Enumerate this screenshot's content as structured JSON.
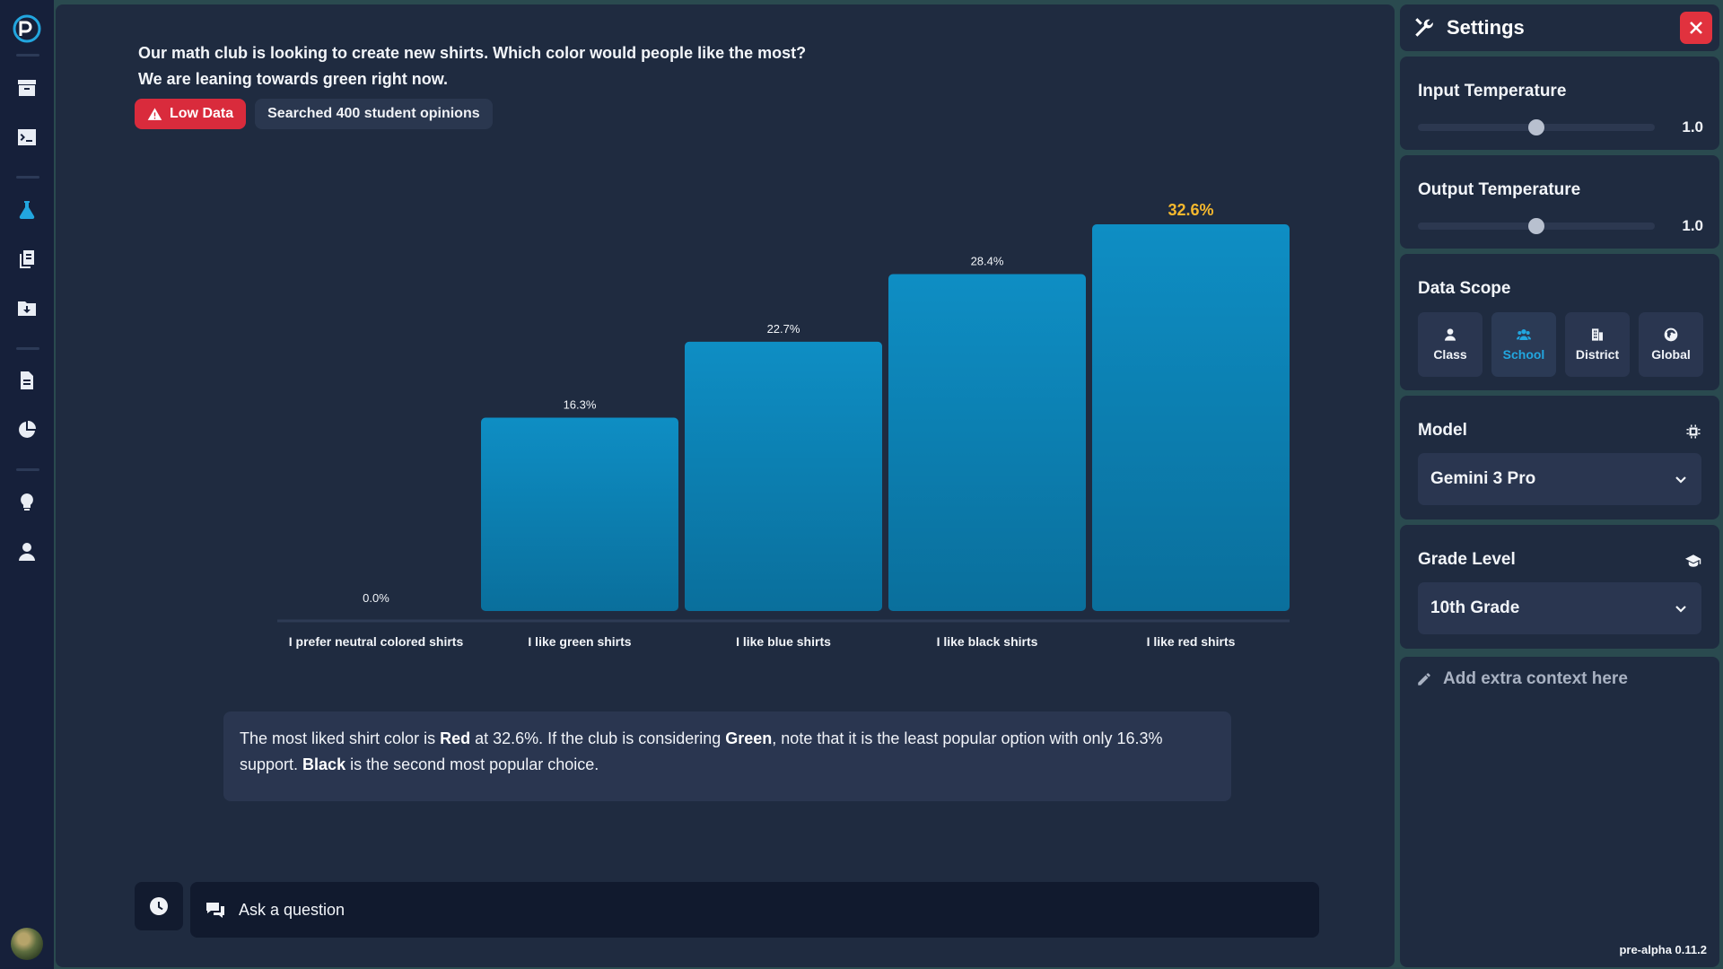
{
  "rail": {
    "icons": [
      "logo-icon",
      "archive-icon",
      "terminal-icon",
      "flask-icon",
      "copy-icon",
      "folder-download-icon",
      "document-icon",
      "pie-chart-icon",
      "lightbulb-icon",
      "user-icon"
    ],
    "active": "flask-icon"
  },
  "question": {
    "line1": "Our math club is looking to create new shirts. Which color would people like the most?",
    "line2": "We are leaning towards green right now."
  },
  "badges": {
    "warning": "Low Data",
    "searched": "Searched 400 student opinions"
  },
  "chart_data": {
    "type": "bar",
    "categories": [
      "I prefer neutral colored shirts",
      "I like green shirts",
      "I like blue shirts",
      "I like black shirts",
      "I like red shirts"
    ],
    "values": [
      0.0,
      16.3,
      22.7,
      28.4,
      32.6
    ],
    "data_labels": [
      "0.0%",
      "16.3%",
      "22.7%",
      "28.4%",
      "32.6%"
    ],
    "highlighted": "I like red shirts",
    "ylim": [
      0,
      32.6
    ],
    "colors": {
      "bar": "#0c8bbf",
      "highlight_label": "#f5b82e",
      "label": "#f2f5f9"
    }
  },
  "summary": {
    "p1": "The most liked shirt color is ",
    "b1": "Red",
    "p2": " at 32.6%. If the club is considering ",
    "b2": "Green",
    "p3": ", note that it is the least popular option with only 16.3% support. ",
    "b3": "Black",
    "p4": " is the second most popular choice."
  },
  "ask": {
    "placeholder": "Ask a question"
  },
  "settings": {
    "title": "Settings",
    "input_temperature": {
      "label": "Input Temperature",
      "value": "1.0",
      "fraction": 0.5
    },
    "output_temperature": {
      "label": "Output Temperature",
      "value": "1.0",
      "fraction": 0.5
    },
    "data_scope": {
      "label": "Data Scope",
      "options": [
        "Class",
        "School",
        "District",
        "Global"
      ],
      "selected": "School"
    },
    "model": {
      "label": "Model",
      "value": "Gemini 3 Pro"
    },
    "grade_level": {
      "label": "Grade Level",
      "value": "10th Grade"
    },
    "context_placeholder": "Add extra context here",
    "version": "pre-alpha 0.11.2"
  }
}
